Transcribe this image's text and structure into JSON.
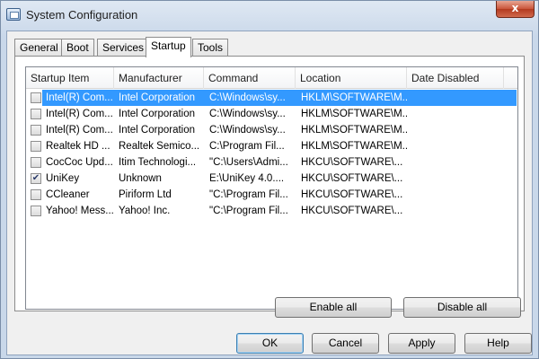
{
  "window": {
    "title": "System Configuration",
    "close_glyph": "x"
  },
  "tabs": [
    {
      "label": "General"
    },
    {
      "label": "Boot"
    },
    {
      "label": "Services"
    },
    {
      "label": "Startup"
    },
    {
      "label": "Tools"
    }
  ],
  "active_tab": "Startup",
  "table": {
    "columns": [
      "Startup Item",
      "Manufacturer",
      "Command",
      "Location",
      "Date Disabled"
    ],
    "rows": [
      {
        "checked": false,
        "selected": true,
        "item": "Intel(R) Com...",
        "manufacturer": "Intel Corporation",
        "command": "C:\\Windows\\sy...",
        "location": "HKLM\\SOFTWARE\\M...",
        "date_disabled": ""
      },
      {
        "checked": false,
        "selected": false,
        "item": "Intel(R) Com...",
        "manufacturer": "Intel Corporation",
        "command": "C:\\Windows\\sy...",
        "location": "HKLM\\SOFTWARE\\M...",
        "date_disabled": ""
      },
      {
        "checked": false,
        "selected": false,
        "item": "Intel(R) Com...",
        "manufacturer": "Intel Corporation",
        "command": "C:\\Windows\\sy...",
        "location": "HKLM\\SOFTWARE\\M...",
        "date_disabled": ""
      },
      {
        "checked": false,
        "selected": false,
        "item": "Realtek HD ...",
        "manufacturer": "Realtek Semico...",
        "command": "C:\\Program Fil...",
        "location": "HKLM\\SOFTWARE\\M...",
        "date_disabled": ""
      },
      {
        "checked": false,
        "selected": false,
        "item": "CocCoc Upd...",
        "manufacturer": "Itim Technologi...",
        "command": "\"C:\\Users\\Admi...",
        "location": "HKCU\\SOFTWARE\\...",
        "date_disabled": ""
      },
      {
        "checked": true,
        "selected": false,
        "item": "UniKey",
        "manufacturer": "Unknown",
        "command": "E:\\UniKey 4.0....",
        "location": "HKCU\\SOFTWARE\\...",
        "date_disabled": ""
      },
      {
        "checked": false,
        "selected": false,
        "item": "CCleaner",
        "manufacturer": "Piriform Ltd",
        "command": "\"C:\\Program Fil...",
        "location": "HKCU\\SOFTWARE\\...",
        "date_disabled": ""
      },
      {
        "checked": false,
        "selected": false,
        "item": "Yahoo! Mess...",
        "manufacturer": "Yahoo! Inc.",
        "command": "\"C:\\Program Fil...",
        "location": "HKCU\\SOFTWARE\\...",
        "date_disabled": ""
      }
    ]
  },
  "buttons": {
    "enable_all": "Enable all",
    "disable_all": "Disable all",
    "ok": "OK",
    "cancel": "Cancel",
    "apply": "Apply",
    "help": "Help"
  },
  "colors": {
    "selection": "#3399ff",
    "close_button": "#c9553a"
  },
  "icons": {
    "app": "system-config-icon",
    "close": "close-icon",
    "check": "checkmark-icon"
  }
}
